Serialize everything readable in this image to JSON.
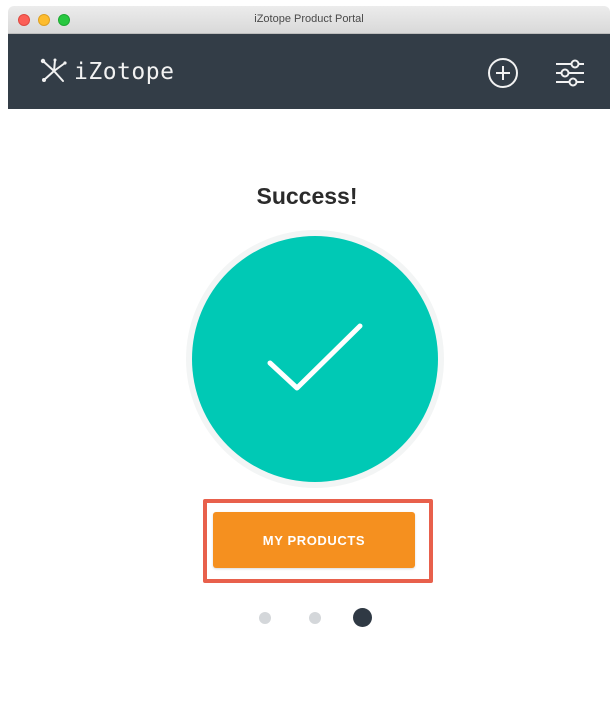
{
  "window": {
    "title": "iZotope Product Portal"
  },
  "header": {
    "logo_text": "iZotope",
    "icons": [
      "add-icon",
      "settings-sliders-icon"
    ]
  },
  "main": {
    "title": "Success!",
    "status_icon": "checkmark-icon",
    "primary_button_label": "MY PRODUCTS"
  },
  "pagination": {
    "total_pages": 3,
    "current_page": 3
  },
  "colors": {
    "header_bg": "#333d47",
    "success_circle": "#00c9b5",
    "button_bg": "#f5901f",
    "highlight_border": "#e8604c",
    "dot_active": "#2f3944",
    "dot_inactive": "#d4d7da"
  }
}
